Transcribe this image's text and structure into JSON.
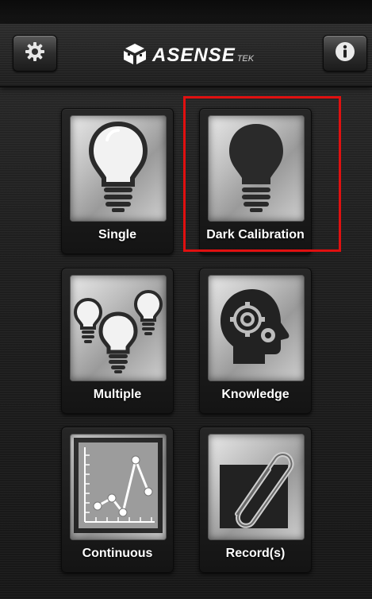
{
  "header": {
    "logo_text": "ASENSE",
    "logo_suffix": "TEK",
    "settings_icon": "gear-icon",
    "info_icon": "info-icon"
  },
  "tiles": [
    {
      "label": "Single",
      "icon": "lightbulb-icon"
    },
    {
      "label": "Dark Calibration",
      "icon": "dark-lightbulb-icon"
    },
    {
      "label": "Multiple",
      "icon": "multiple-lightbulbs-icon"
    },
    {
      "label": "Knowledge",
      "icon": "head-gears-icon"
    },
    {
      "label": "Continuous",
      "icon": "line-chart-icon"
    },
    {
      "label": "Record(s)",
      "icon": "paperclip-icon"
    }
  ],
  "colors": {
    "highlight": "#e01010",
    "background": "#1f1f1f",
    "label": "#ffffff"
  }
}
